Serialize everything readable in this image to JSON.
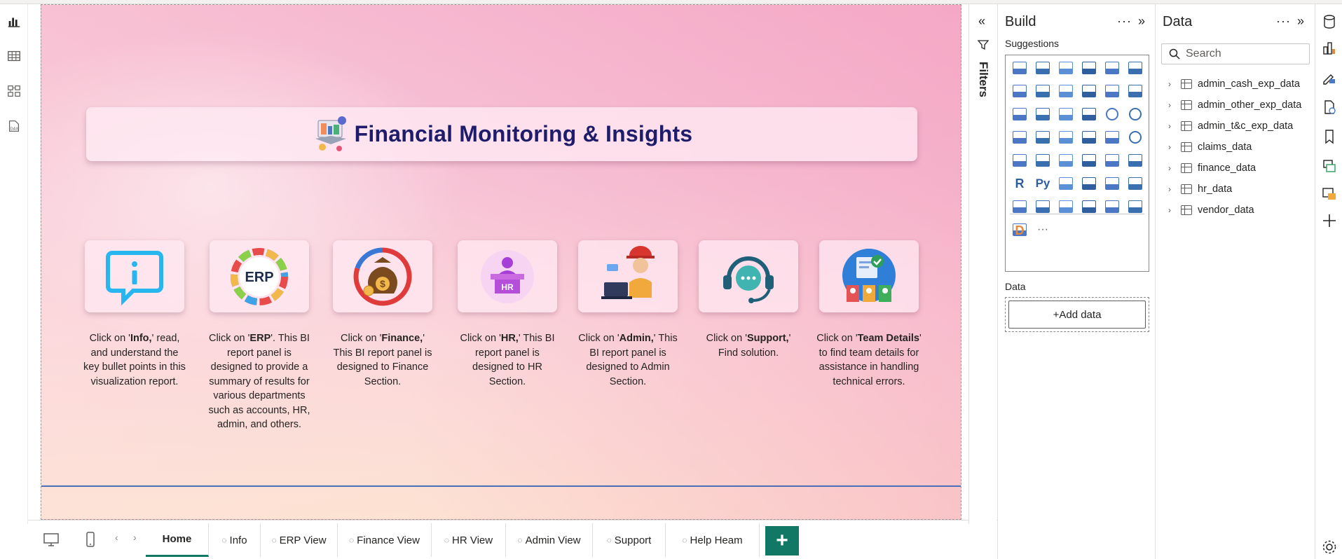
{
  "report": {
    "title": "Financial Monitoring & Insights",
    "cards": [
      {
        "key": "info",
        "icon": "info-icon",
        "pre": "Click on '",
        "bold": "Info,",
        "post": "' read, and understand the key bullet points in this visualization report."
      },
      {
        "key": "erp",
        "icon": "erp-icon",
        "label": "ERP",
        "pre": "Click on '",
        "bold": "ERP",
        "post": "'. This BI report panel is designed to provide a summary of results for various departments such as accounts, HR, admin, and others."
      },
      {
        "key": "finance",
        "icon": "finance-money-bag-icon",
        "pre": "Click on '",
        "bold": "Finance,",
        "post": "' This BI report panel is designed to Finance Section."
      },
      {
        "key": "hr",
        "icon": "hr-desk-icon",
        "label": "HR",
        "pre": "Click on '",
        "bold": "HR,",
        "post": "' This BI report panel is designed to HR Section."
      },
      {
        "key": "admin",
        "icon": "admin-worker-icon",
        "pre": "Click on '",
        "bold": "Admin,",
        "post": "' This BI report panel is designed to Admin Section."
      },
      {
        "key": "support",
        "icon": "support-headset-icon",
        "pre": "Click on '",
        "bold": "Support,",
        "post": "' Find solution."
      },
      {
        "key": "team",
        "icon": "team-details-icon",
        "pre": "Click on '",
        "bold": "Team Details",
        "post": "' to find team details for assistance in handling technical errors."
      }
    ]
  },
  "tabs": [
    {
      "label": "Home",
      "active": true,
      "hidden": false
    },
    {
      "label": "Info",
      "active": false,
      "hidden": true
    },
    {
      "label": "ERP View",
      "active": false,
      "hidden": true
    },
    {
      "label": "Finance View",
      "active": false,
      "hidden": true
    },
    {
      "label": "HR View",
      "active": false,
      "hidden": true
    },
    {
      "label": "Admin View",
      "active": false,
      "hidden": true
    },
    {
      "label": "Support",
      "active": false,
      "hidden": true
    },
    {
      "label": "Help Heam",
      "active": false,
      "hidden": true
    }
  ],
  "add_tab_label": "+",
  "filters": {
    "label": "Filters"
  },
  "build": {
    "title": "Build",
    "suggestions_label": "Suggestions",
    "data_label": "Data",
    "add_data_label": "+Add data",
    "more_label": "···"
  },
  "data_pane": {
    "title": "Data",
    "search_placeholder": "Search",
    "tables": [
      "admin_cash_exp_data",
      "admin_other_exp_data",
      "admin_t&c_exp_data",
      "claims_data",
      "finance_data",
      "hr_data",
      "vendor_data"
    ]
  },
  "colors": {
    "accent": "#117865",
    "title_text": "#1f1d6b",
    "divider": "#4a6fb6"
  }
}
